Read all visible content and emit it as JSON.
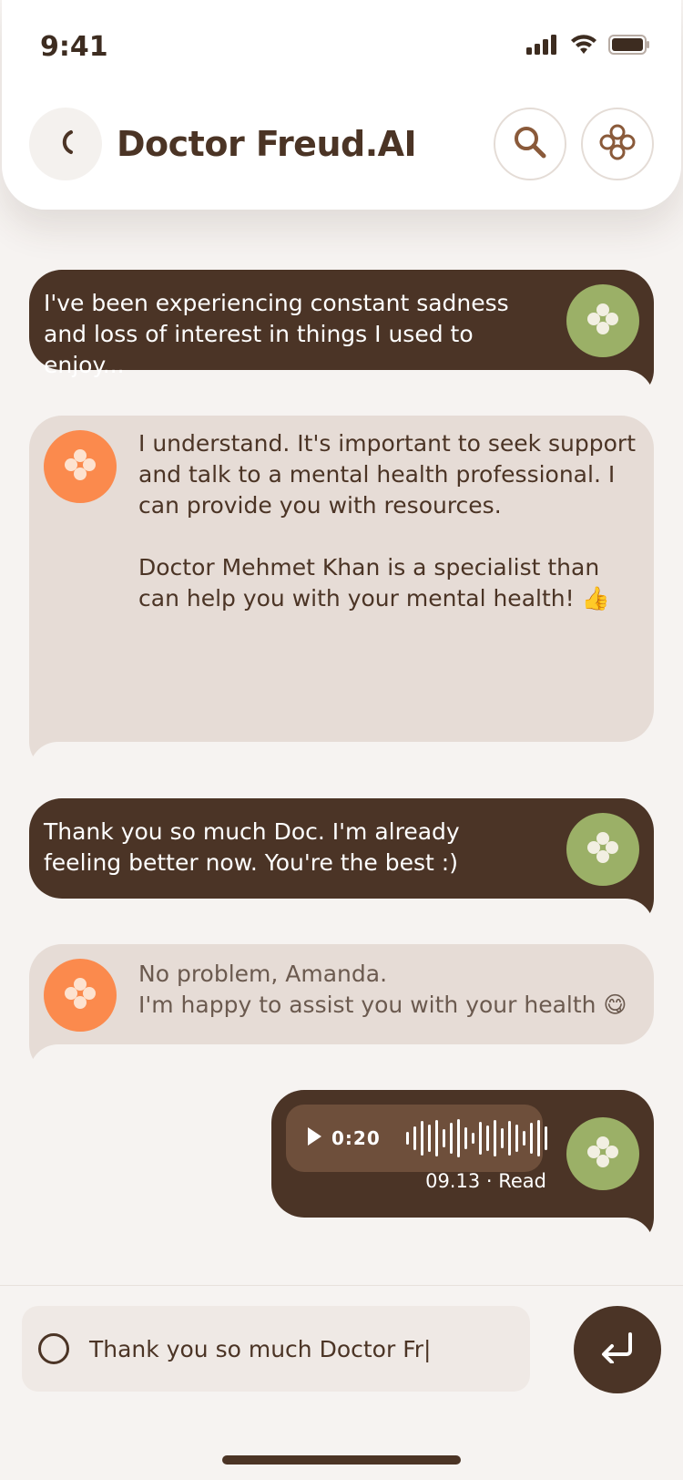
{
  "status_bar": {
    "time": "9:41"
  },
  "header": {
    "title": "Doctor Freud.AI"
  },
  "messages": [
    {
      "sender": "user",
      "text": "I've been experiencing constant sadness and loss of interest in things I used to enjoy..."
    },
    {
      "sender": "bot",
      "text": "I understand. It's important to seek support and talk to a mental health professional. I can provide you with resources.\n\nDoctor Mehmet Khan is a specialist than can help you with your mental health! 👍"
    },
    {
      "sender": "user",
      "text": "Thank you so much Doc. I'm already feeling better now. You're the best :)"
    },
    {
      "sender": "bot",
      "text": "No problem, Amanda.\nI'm happy to assist you with your health 😋"
    }
  ],
  "voice_note": {
    "duration": "0:20",
    "meta": "09.13 · Read"
  },
  "composer": {
    "value": "Thank you so much Doctor Fr|"
  },
  "colors": {
    "brown": "#4b3426",
    "green": "#9bb067",
    "orange": "#fb8a4d",
    "bot_bubble": "#e6dcd6",
    "background": "#f6f3f1"
  },
  "icons": [
    "signal-icon",
    "wifi-icon",
    "battery-icon",
    "back-icon",
    "search-icon",
    "flower-icon",
    "play-icon",
    "waveform-icon",
    "emoji-icon",
    "send-icon"
  ]
}
